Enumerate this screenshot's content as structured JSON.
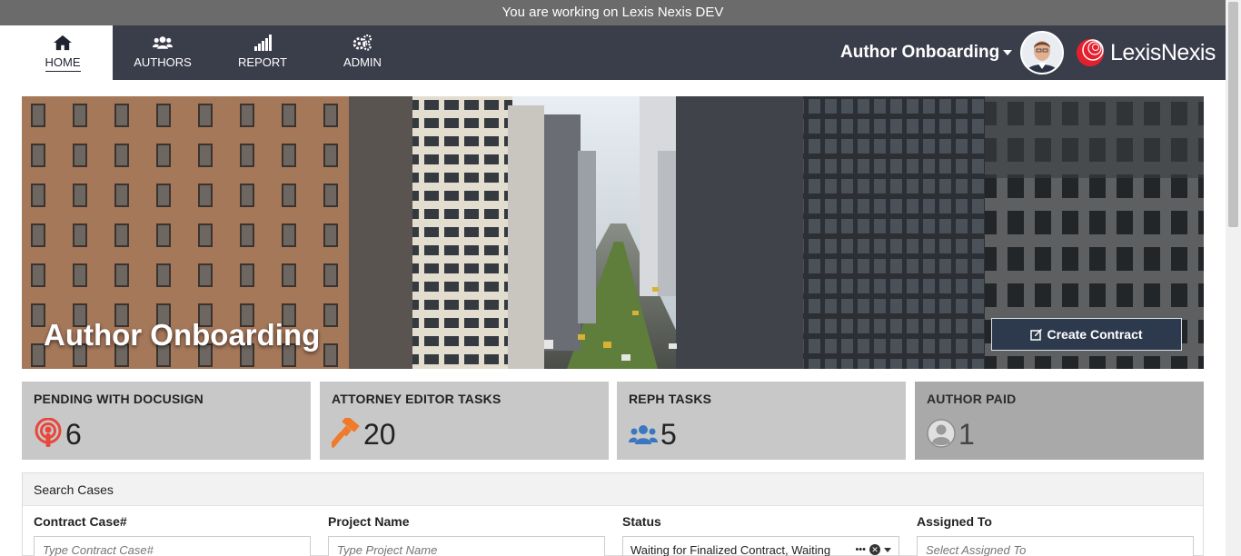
{
  "env_banner": "You are working on Lexis Nexis DEV",
  "nav": {
    "items": [
      {
        "label": "HOME",
        "icon": "home-icon",
        "active": true
      },
      {
        "label": "AUTHORS",
        "icon": "users-icon"
      },
      {
        "label": "REPORT",
        "icon": "signal-bars-icon"
      },
      {
        "label": "ADMIN",
        "icon": "gears-icon"
      }
    ],
    "app_title": "Author Onboarding",
    "brand": "LexisNexis"
  },
  "hero": {
    "title": "Author Onboarding",
    "create_button": "Create Contract"
  },
  "cards": [
    {
      "title": "PENDING WITH DOCUSIGN",
      "count": "6",
      "icon": "podcast-icon",
      "color": "#e8473c"
    },
    {
      "title": "ATTORNEY EDITOR TASKS",
      "count": "20",
      "icon": "gavel-icon",
      "color": "#f07a2a"
    },
    {
      "title": "REPH TASKS",
      "count": "5",
      "icon": "users-icon",
      "color": "#3a77c0"
    },
    {
      "title": "AUTHOR PAID",
      "count": "1",
      "icon": "user-circle-icon",
      "color": "#9a9a9a"
    }
  ],
  "search": {
    "heading": "Search Cases",
    "fields": {
      "contract": {
        "label": "Contract Case#",
        "placeholder": "Type Contract Case#"
      },
      "project": {
        "label": "Project Name",
        "placeholder": "Type Project Name"
      },
      "status": {
        "label": "Status",
        "value": "Waiting for Finalized Contract, Waiting"
      },
      "assigned": {
        "label": "Assigned To",
        "placeholder": "Select Assigned To"
      }
    }
  },
  "colors": {
    "nav_bg": "#3a3d4a",
    "env_bar": "#6b6b6b",
    "button_bg": "#2d3a4d",
    "card_bg": "#c8c8c8",
    "card_bg_dark": "#a9a9a9"
  }
}
